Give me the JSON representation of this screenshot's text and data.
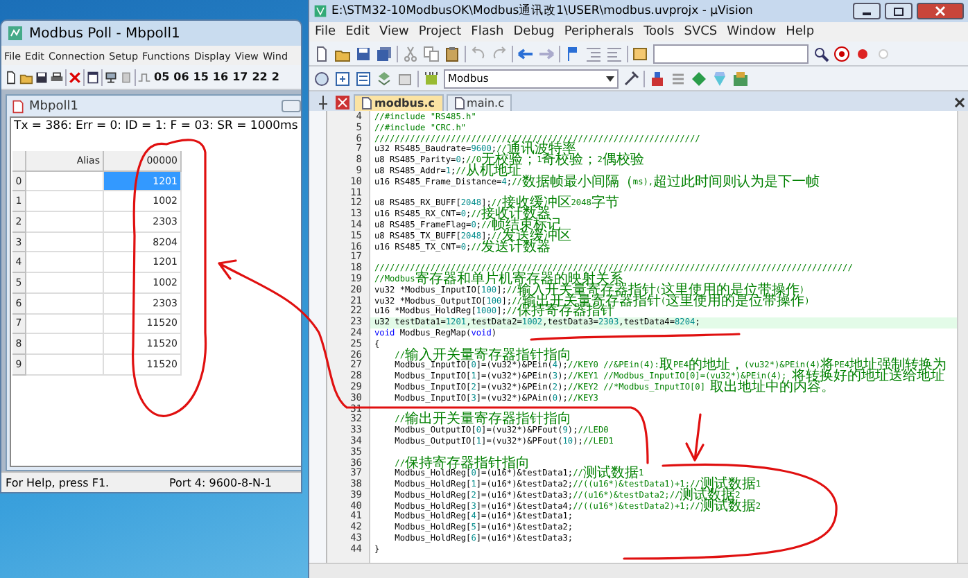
{
  "modbus_poll": {
    "title": "Modbus Poll - Mbpoll1",
    "menu": [
      "File",
      "Edit",
      "Connection",
      "Setup",
      "Functions",
      "Display",
      "View",
      "Wind"
    ],
    "function_codes": [
      "05",
      "06",
      "15",
      "16",
      "17",
      "22",
      "2"
    ],
    "child_window": {
      "title": "Mbpoll1",
      "status_line": "Tx = 386: Err = 0: ID = 1: F = 03: SR = 1000ms",
      "columns": [
        "Alias",
        "00000"
      ],
      "rows": [
        {
          "index": "0",
          "value": "1201",
          "selected": true
        },
        {
          "index": "1",
          "value": "1002",
          "selected": false
        },
        {
          "index": "2",
          "value": "2303",
          "selected": false
        },
        {
          "index": "3",
          "value": "8204",
          "selected": false
        },
        {
          "index": "4",
          "value": "1201",
          "selected": false
        },
        {
          "index": "5",
          "value": "1002",
          "selected": false
        },
        {
          "index": "6",
          "value": "2303",
          "selected": false
        },
        {
          "index": "7",
          "value": "11520",
          "selected": false
        },
        {
          "index": "8",
          "value": "11520",
          "selected": false
        },
        {
          "index": "9",
          "value": "11520",
          "selected": false
        }
      ]
    },
    "status_bar": [
      "For Help, press F1.",
      "Port 4: 9600-8-N-1"
    ]
  },
  "uvision": {
    "title": "E:\\STM32-10ModbusOK\\Modbus通讯改1\\USER\\modbus.uvprojx - µVision",
    "menu": [
      "File",
      "Edit",
      "View",
      "Project",
      "Flash",
      "Debug",
      "Peripherals",
      "Tools",
      "SVCS",
      "Window",
      "Help"
    ],
    "target": "Modbus",
    "tabs": [
      {
        "label": "modbus.c",
        "selected": true
      },
      {
        "label": "main.c",
        "selected": false
      }
    ],
    "code_lines": [
      {
        "number": "4",
        "highlighted": false,
        "segments": [
          {
            "kind": "comment",
            "text": "//#include \"RS485.h\""
          }
        ]
      },
      {
        "number": "5",
        "highlighted": false,
        "segments": [
          {
            "kind": "comment",
            "text": "//#include \"CRC.h\""
          }
        ]
      },
      {
        "number": "6",
        "highlighted": false,
        "segments": [
          {
            "kind": "comment",
            "text": "////////////////////////////////////////////////////////////////"
          }
        ]
      },
      {
        "number": "7",
        "highlighted": false,
        "segments": [
          {
            "kind": "code",
            "text": "u32 RS485_Baudrate="
          },
          {
            "kind": "number",
            "text": "9600"
          },
          {
            "kind": "code",
            "text": ";"
          },
          {
            "kind": "comment",
            "text": "//通讯波特率"
          }
        ]
      },
      {
        "number": "8",
        "highlighted": false,
        "segments": [
          {
            "kind": "code",
            "text": "u8 RS485_Parity="
          },
          {
            "kind": "number",
            "text": "0"
          },
          {
            "kind": "code",
            "text": ";"
          },
          {
            "kind": "comment",
            "text": "//0无校验；1奇校验；2偶校验"
          }
        ]
      },
      {
        "number": "9",
        "highlighted": false,
        "segments": [
          {
            "kind": "code",
            "text": "u8 RS485_Addr="
          },
          {
            "kind": "number",
            "text": "1"
          },
          {
            "kind": "code",
            "text": ";"
          },
          {
            "kind": "comment",
            "text": "//从机地址"
          }
        ]
      },
      {
        "number": "10",
        "highlighted": false,
        "segments": [
          {
            "kind": "code",
            "text": "u16 RS485_Frame_Distance="
          },
          {
            "kind": "number",
            "text": "4"
          },
          {
            "kind": "code",
            "text": ";"
          },
          {
            "kind": "comment",
            "text": "//数据帧最小间隔（ms),超过此时间则认为是下一帧"
          }
        ]
      },
      {
        "number": "11",
        "highlighted": false
      },
      {
        "number": "12",
        "highlighted": false,
        "segments": [
          {
            "kind": "code",
            "text": "u8 RS485_RX_BUFF["
          },
          {
            "kind": "number",
            "text": "2048"
          },
          {
            "kind": "code",
            "text": "];"
          },
          {
            "kind": "comment",
            "text": "//接收缓冲区2048字节"
          }
        ]
      },
      {
        "number": "13",
        "highlighted": false,
        "segments": [
          {
            "kind": "code",
            "text": "u16 RS485_RX_CNT="
          },
          {
            "kind": "number",
            "text": "0"
          },
          {
            "kind": "code",
            "text": ";"
          },
          {
            "kind": "comment",
            "text": "//接收计数器"
          }
        ]
      },
      {
        "number": "14",
        "highlighted": false,
        "segments": [
          {
            "kind": "code",
            "text": "u8 RS485_FrameFlag="
          },
          {
            "kind": "number",
            "text": "0"
          },
          {
            "kind": "code",
            "text": ";"
          },
          {
            "kind": "comment",
            "text": "//帧结束标记"
          }
        ]
      },
      {
        "number": "15",
        "highlighted": false,
        "segments": [
          {
            "kind": "code",
            "text": "u8 RS485_TX_BUFF["
          },
          {
            "kind": "number",
            "text": "2048"
          },
          {
            "kind": "code",
            "text": "];"
          },
          {
            "kind": "comment",
            "text": "//发送缓冲区"
          }
        ]
      },
      {
        "number": "16",
        "highlighted": false,
        "segments": [
          {
            "kind": "code",
            "text": "u16 RS485_TX_CNT="
          },
          {
            "kind": "number",
            "text": "0"
          },
          {
            "kind": "code",
            "text": ";"
          },
          {
            "kind": "comment",
            "text": "//发送计数器"
          }
        ]
      },
      {
        "number": "17",
        "highlighted": false
      },
      {
        "number": "18",
        "highlighted": false,
        "segments": [
          {
            "kind": "comment",
            "text": "//////////////////////////////////////////////////////////////////////////////////////////////"
          }
        ]
      },
      {
        "number": "19",
        "highlighted": false,
        "segments": [
          {
            "kind": "comment",
            "text": "//Modbus寄存器和单片机寄存器的映射关系"
          }
        ]
      },
      {
        "number": "20",
        "highlighted": false,
        "segments": [
          {
            "kind": "code",
            "text": "vu32 *Modbus_InputIO["
          },
          {
            "kind": "number",
            "text": "100"
          },
          {
            "kind": "code",
            "text": "];"
          },
          {
            "kind": "comment",
            "text": "//输入开关量寄存器指针(这里使用的是位带操作)"
          }
        ]
      },
      {
        "number": "21",
        "highlighted": false,
        "segments": [
          {
            "kind": "code",
            "text": "vu32 *Modbus_OutputIO["
          },
          {
            "kind": "number",
            "text": "100"
          },
          {
            "kind": "code",
            "text": "];"
          },
          {
            "kind": "comment",
            "text": "//输出开关量寄存器指针(这里使用的是位带操作)"
          }
        ]
      },
      {
        "number": "22",
        "highlighted": false,
        "segments": [
          {
            "kind": "code",
            "text": "u16 *Modbus_HoldReg["
          },
          {
            "kind": "number",
            "text": "1000"
          },
          {
            "kind": "code",
            "text": "];"
          },
          {
            "kind": "comment",
            "text": "//保持寄存器指针"
          }
        ]
      },
      {
        "number": "23",
        "highlighted": true,
        "segments": [
          {
            "kind": "code",
            "text": "u32 testData1="
          },
          {
            "kind": "number",
            "text": "1201"
          },
          {
            "kind": "code",
            "text": ",testData2="
          },
          {
            "kind": "number",
            "text": "1002"
          },
          {
            "kind": "code",
            "text": ",testData3="
          },
          {
            "kind": "number",
            "text": "2303"
          },
          {
            "kind": "code",
            "text": ",testData4="
          },
          {
            "kind": "number",
            "text": "8204"
          },
          {
            "kind": "code",
            "text": ";"
          }
        ]
      },
      {
        "number": "24",
        "highlighted": false,
        "segments": [
          {
            "kind": "keyword",
            "text": "void"
          },
          {
            "kind": "code",
            "text": " Modbus_RegMap("
          },
          {
            "kind": "keyword",
            "text": "void"
          },
          {
            "kind": "code",
            "text": ")"
          }
        ]
      },
      {
        "number": "25",
        "highlighted": false,
        "segments": [
          {
            "kind": "code",
            "text": "{"
          }
        ]
      },
      {
        "number": "26",
        "highlighted": false,
        "segments": [
          {
            "kind": "comment",
            "text": "    //输入开关量寄存器指针指向"
          }
        ]
      },
      {
        "number": "27",
        "highlighted": false,
        "segments": [
          {
            "kind": "code",
            "text": "    Modbus_InputIO["
          },
          {
            "kind": "number",
            "text": "0"
          },
          {
            "kind": "code",
            "text": "]=(vu32*)&PEin("
          },
          {
            "kind": "number",
            "text": "4"
          },
          {
            "kind": "code",
            "text": ");"
          },
          {
            "kind": "comment",
            "text": "//KEY0 //&PEin(4):取PE4的地址，(vu32*)&PEin(4)将PE4地址强制转换为"
          }
        ]
      },
      {
        "number": "28",
        "highlighted": false,
        "segments": [
          {
            "kind": "code",
            "text": "    Modbus_InputIO["
          },
          {
            "kind": "number",
            "text": "1"
          },
          {
            "kind": "code",
            "text": "]=(vu32*)&PEin("
          },
          {
            "kind": "number",
            "text": "3"
          },
          {
            "kind": "code",
            "text": ");"
          },
          {
            "kind": "comment",
            "text": "//KEY1 //Modbus_InputIO[0]=(vu32*)&PEin(4); 将转换好的地址送给地址"
          }
        ]
      },
      {
        "number": "29",
        "highlighted": false,
        "segments": [
          {
            "kind": "code",
            "text": "    Modbus_InputIO["
          },
          {
            "kind": "number",
            "text": "2"
          },
          {
            "kind": "code",
            "text": "]=(vu32*)&PEin("
          },
          {
            "kind": "number",
            "text": "2"
          },
          {
            "kind": "code",
            "text": ");"
          },
          {
            "kind": "comment",
            "text": "//KEY2 //*Modbus_InputIO[0] 取出地址中的内容。"
          }
        ]
      },
      {
        "number": "30",
        "highlighted": false,
        "segments": [
          {
            "kind": "code",
            "text": "    Modbus_InputIO["
          },
          {
            "kind": "number",
            "text": "3"
          },
          {
            "kind": "code",
            "text": "]=(vu32*)&PAin("
          },
          {
            "kind": "number",
            "text": "0"
          },
          {
            "kind": "code",
            "text": ");"
          },
          {
            "kind": "comment",
            "text": "//KEY3"
          }
        ]
      },
      {
        "number": "31",
        "highlighted": false
      },
      {
        "number": "32",
        "highlighted": false,
        "segments": [
          {
            "kind": "comment",
            "text": "    //输出开关量寄存器指针指向"
          }
        ]
      },
      {
        "number": "33",
        "highlighted": false,
        "segments": [
          {
            "kind": "code",
            "text": "    Modbus_OutputIO["
          },
          {
            "kind": "number",
            "text": "0"
          },
          {
            "kind": "code",
            "text": "]=(vu32*)&PFout("
          },
          {
            "kind": "number",
            "text": "9"
          },
          {
            "kind": "code",
            "text": ");"
          },
          {
            "kind": "comment",
            "text": "//LED0"
          }
        ]
      },
      {
        "number": "34",
        "highlighted": false,
        "segments": [
          {
            "kind": "code",
            "text": "    Modbus_OutputIO["
          },
          {
            "kind": "number",
            "text": "1"
          },
          {
            "kind": "code",
            "text": "]=(vu32*)&PFout("
          },
          {
            "kind": "number",
            "text": "10"
          },
          {
            "kind": "code",
            "text": ");"
          },
          {
            "kind": "comment",
            "text": "//LED1"
          }
        ]
      },
      {
        "number": "35",
        "highlighted": false
      },
      {
        "number": "36",
        "highlighted": false,
        "segments": [
          {
            "kind": "comment",
            "text": "    //保持寄存器指针指向"
          }
        ]
      },
      {
        "number": "37",
        "highlighted": false,
        "segments": [
          {
            "kind": "code",
            "text": "    Modbus_HoldReg["
          },
          {
            "kind": "number",
            "text": "0"
          },
          {
            "kind": "code",
            "text": "]=(u16*)&testData1;"
          },
          {
            "kind": "comment",
            "text": "//测试数据1"
          }
        ]
      },
      {
        "number": "38",
        "highlighted": false,
        "segments": [
          {
            "kind": "code",
            "text": "    Modbus_HoldReg["
          },
          {
            "kind": "number",
            "text": "1"
          },
          {
            "kind": "code",
            "text": "]=(u16*)&testData2;"
          },
          {
            "kind": "comment",
            "text": "//((u16*)&testData1)+1;//测试数据1"
          }
        ]
      },
      {
        "number": "39",
        "highlighted": false,
        "segments": [
          {
            "kind": "code",
            "text": "    Modbus_HoldReg["
          },
          {
            "kind": "number",
            "text": "2"
          },
          {
            "kind": "code",
            "text": "]=(u16*)&testData3;"
          },
          {
            "kind": "comment",
            "text": "//(u16*)&testData2;//测试数据2"
          }
        ]
      },
      {
        "number": "40",
        "highlighted": false,
        "segments": [
          {
            "kind": "code",
            "text": "    Modbus_HoldReg["
          },
          {
            "kind": "number",
            "text": "3"
          },
          {
            "kind": "code",
            "text": "]=(u16*)&testData4;"
          },
          {
            "kind": "comment",
            "text": "//((u16*)&testData2)+1;//测试数据2"
          }
        ]
      },
      {
        "number": "41",
        "highlighted": false,
        "segments": [
          {
            "kind": "code",
            "text": "    Modbus_HoldReg["
          },
          {
            "kind": "number",
            "text": "4"
          },
          {
            "kind": "code",
            "text": "]=(u16*)&testData1;"
          }
        ]
      },
      {
        "number": "42",
        "highlighted": false,
        "segments": [
          {
            "kind": "code",
            "text": "    Modbus_HoldReg["
          },
          {
            "kind": "number",
            "text": "5"
          },
          {
            "kind": "code",
            "text": "]=(u16*)&testData2;"
          }
        ]
      },
      {
        "number": "43",
        "highlighted": false,
        "segments": [
          {
            "kind": "code",
            "text": "    Modbus_HoldReg["
          },
          {
            "kind": "number",
            "text": "6"
          },
          {
            "kind": "code",
            "text": "]=(u16*)&testData3;"
          }
        ]
      },
      {
        "number": "44",
        "highlighted": false,
        "segments": [
          {
            "kind": "code",
            "text": "}"
          }
        ]
      }
    ]
  }
}
